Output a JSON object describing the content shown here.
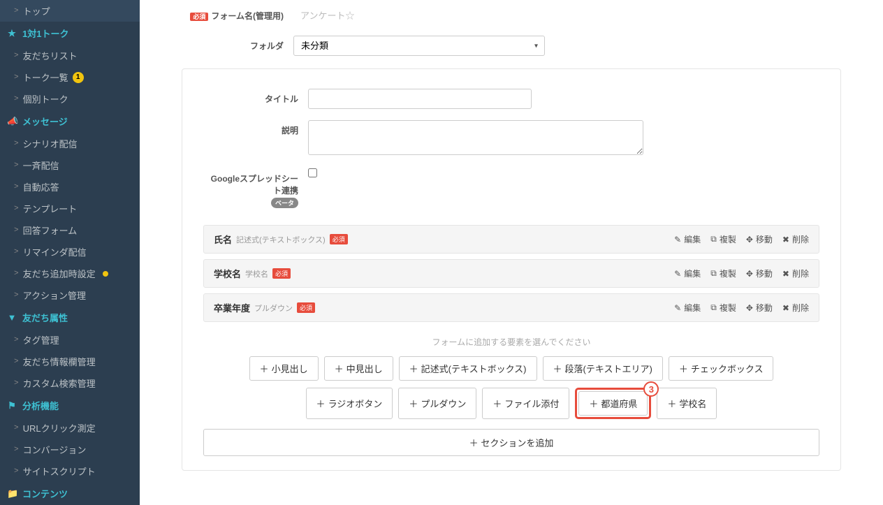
{
  "sidebar": {
    "top": "トップ",
    "one_on_one": "1対1トーク",
    "friend_list": "友だちリスト",
    "talk_list": "トーク一覧",
    "talk_badge": "1",
    "individual_talk": "個別トーク",
    "message": "メッセージ",
    "scenario": "シナリオ配信",
    "broadcast": "一斉配信",
    "auto_reply": "自動応答",
    "template": "テンプレート",
    "answer_form": "回答フォーム",
    "reminder": "リマインダ配信",
    "friend_add_setting": "友だち追加時設定",
    "action_mgmt": "アクション管理",
    "friend_attr": "友だち属性",
    "tag_mgmt": "タグ管理",
    "friend_info_mgmt": "友だち情報欄管理",
    "custom_search_mgmt": "カスタム検索管理",
    "analytics": "分析機能",
    "url_click": "URLクリック測定",
    "conversion": "コンバージョン",
    "site_script": "サイトスクリプト",
    "contents": "コンテンツ"
  },
  "form": {
    "name_label": "フォーム名(管理用)",
    "name_value": "アンケート☆",
    "folder_label": "フォルダ",
    "folder_value": "未分類",
    "title_label": "タイトル",
    "title_value": "",
    "desc_label": "説明",
    "desc_value": "",
    "sheet_label": "Googleスプレッドシート連携",
    "beta": "ベータ",
    "required": "必須"
  },
  "fields": [
    {
      "name": "氏名",
      "type": "記述式(テキストボックス)"
    },
    {
      "name": "学校名",
      "type": "学校名"
    },
    {
      "name": "卒業年度",
      "type": "プルダウン"
    }
  ],
  "actions": {
    "edit": "編集",
    "copy": "複製",
    "move": "移動",
    "delete": "削除"
  },
  "add": {
    "hint": "フォームに追加する要素を選んでください",
    "small_heading": "小見出し",
    "mid_heading": "中見出し",
    "textbox": "記述式(テキストボックス)",
    "textarea": "段落(テキストエリア)",
    "checkbox": "チェックボックス",
    "radio": "ラジオボタン",
    "pulldown": "プルダウン",
    "file": "ファイル添付",
    "prefecture": "都道府県",
    "school": "学校名",
    "section": "セクションを追加"
  },
  "highlight_num": "3"
}
